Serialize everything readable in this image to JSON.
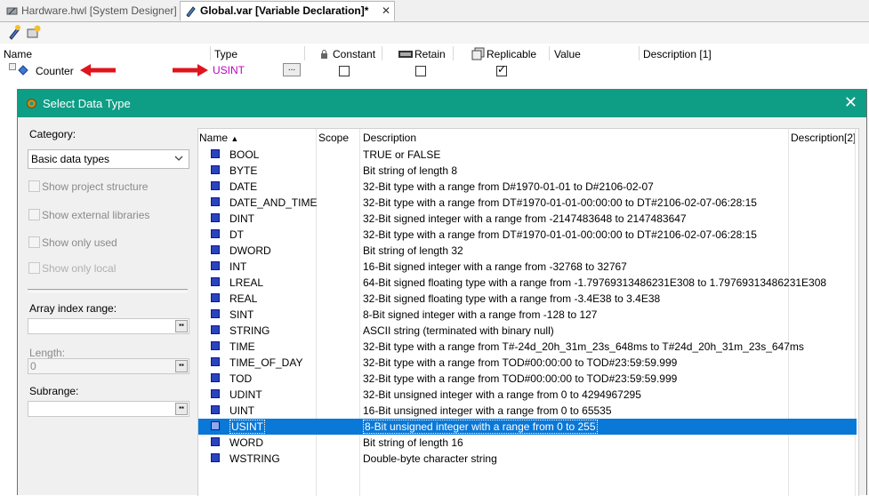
{
  "tabs": [
    {
      "label": "Hardware.hwl [System Designer]"
    },
    {
      "label": "Global.var [Variable Declaration]*",
      "close": "✕"
    }
  ],
  "var_table": {
    "headers": {
      "name": "Name",
      "type": "Type",
      "constant": "Constant",
      "retain": "Retain",
      "replicable": "Replicable",
      "value": "Value",
      "description": "Description [1]"
    },
    "row": {
      "name": "Counter",
      "type": "USINT",
      "browse": "...",
      "constant": false,
      "retain": false,
      "replicable": true
    }
  },
  "dialog": {
    "title": "Select Data Type",
    "close": "✕",
    "category_label": "Category:",
    "category_value": "Basic data types",
    "options": [
      {
        "label": "Show project structure"
      },
      {
        "label": "Show external libraries"
      },
      {
        "label": "Show only used"
      },
      {
        "label": "Show only local"
      }
    ],
    "array_index_label": "Array index range:",
    "length_label": "Length:",
    "length_value": "0",
    "subrange_label": "Subrange:",
    "list_headers": {
      "name": "Name",
      "scope": "Scope",
      "description": "Description",
      "description2": "Description[2]"
    },
    "types": [
      {
        "name": "BOOL",
        "desc": "TRUE or FALSE"
      },
      {
        "name": "BYTE",
        "desc": "Bit string of length 8"
      },
      {
        "name": "DATE",
        "desc": "32-Bit type with a range from D#1970-01-01 to D#2106-02-07"
      },
      {
        "name": "DATE_AND_TIME",
        "desc": "32-Bit type with a range from DT#1970-01-01-00:00:00 to DT#2106-02-07-06:28:15"
      },
      {
        "name": "DINT",
        "desc": "32-Bit signed integer with a range from -2147483648 to 2147483647"
      },
      {
        "name": "DT",
        "desc": "32-Bit type with a range from DT#1970-01-01-00:00:00 to DT#2106-02-07-06:28:15"
      },
      {
        "name": "DWORD",
        "desc": "Bit string of length 32"
      },
      {
        "name": "INT",
        "desc": "16-Bit signed integer with a range from -32768 to 32767"
      },
      {
        "name": "LREAL",
        "desc": "64-Bit signed floating type with a range from -1.79769313486231E308 to 1.79769313486231E308"
      },
      {
        "name": "REAL",
        "desc": "32-Bit signed floating type with a range from -3.4E38 to 3.4E38"
      },
      {
        "name": "SINT",
        "desc": "8-Bit signed integer with a range from -128 to 127"
      },
      {
        "name": "STRING",
        "desc": "ASCII string (terminated with binary null)"
      },
      {
        "name": "TIME",
        "desc": "32-Bit type with a range from T#-24d_20h_31m_23s_648ms to T#24d_20h_31m_23s_647ms"
      },
      {
        "name": "TIME_OF_DAY",
        "desc": "32-Bit type with a range from TOD#00:00:00 to TOD#23:59:59.999"
      },
      {
        "name": "TOD",
        "desc": "32-Bit type with a range from TOD#00:00:00 to TOD#23:59:59.999"
      },
      {
        "name": "UDINT",
        "desc": "32-Bit unsigned integer with a range from 0 to 4294967295"
      },
      {
        "name": "UINT",
        "desc": "16-Bit unsigned integer with a range from 0 to 65535"
      },
      {
        "name": "USINT",
        "desc": "8-Bit unsigned integer with a range from 0 to 255",
        "selected": true
      },
      {
        "name": "WORD",
        "desc": "Bit string of length 16"
      },
      {
        "name": "WSTRING",
        "desc": "Double-byte character string"
      }
    ]
  },
  "colors": {
    "title_bar": "#0e9e86",
    "selection": "#0a78d7",
    "type_text": "#c000c0",
    "arrow": "#e0141e"
  }
}
